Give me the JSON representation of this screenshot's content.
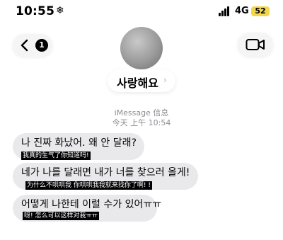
{
  "status_bar": {
    "time": "10:55",
    "focus_glyph": "❄",
    "network": "4G",
    "battery": "52"
  },
  "header": {
    "unread_count": "1",
    "contact_name": "사랑해요",
    "contact_chevron": "›"
  },
  "thread": {
    "service_label": "iMessage 信息",
    "timestamp": "今天 上午 10:54"
  },
  "messages": [
    {
      "text": "나 진짜 화났어. 왜 안 달래?",
      "subtitle": "我真的生气了你知道吗!"
    },
    {
      "text": "네가 나를 달래면 내가 너를 찾으러 올게!",
      "subtitle": "为什么不哄哄我 你哄哄我我就来找你了啊! !"
    },
    {
      "text": "어떻게 나한테 이럴 수가 있어ㅠㅠ",
      "subtitle": "呀! 怎么可以这样对我ㅠㅠ"
    }
  ],
  "icons": {
    "back": "chevron-left-icon",
    "video": "video-camera-icon",
    "signal": "signal-icon",
    "avatar": "contact-avatar"
  },
  "colors": {
    "bubble": "#e9e9eb",
    "battery": "#f2d64b",
    "meta_text": "#8e8e93"
  }
}
